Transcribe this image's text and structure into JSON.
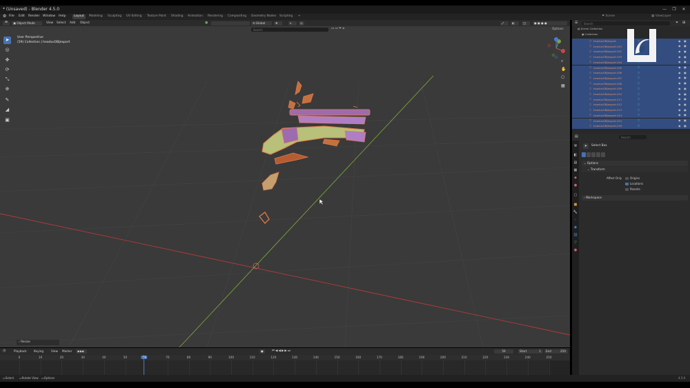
{
  "window": {
    "title": "* (Unsaved) - Blender 4.5.0",
    "controls": [
      "—",
      "❐",
      "✕"
    ]
  },
  "menu": [
    "File",
    "Edit",
    "Render",
    "Window",
    "Help"
  ],
  "workspaces": [
    {
      "label": "Layout",
      "active": true
    },
    {
      "label": "Modeling"
    },
    {
      "label": "Sculpting"
    },
    {
      "label": "UV Editing"
    },
    {
      "label": "Texture Paint"
    },
    {
      "label": "Shading"
    },
    {
      "label": "Animation"
    },
    {
      "label": "Rendering"
    },
    {
      "label": "Compositing"
    },
    {
      "label": "Geometry Nodes"
    },
    {
      "label": "Scripting"
    },
    {
      "label": "+"
    }
  ],
  "scene_label": "Scene",
  "view_layer_label": "ViewLayer",
  "viewport_header": {
    "mode": "Object Mode",
    "menus": [
      "View",
      "Select",
      "Add",
      "Object"
    ],
    "orientation": "Global",
    "search_placeholder": "Search",
    "options_label": "Options"
  },
  "viewport": {
    "perspective": "User Perspective",
    "collection": "(59) Collection | headusOBJexport"
  },
  "redo_panel": "Resize",
  "outliner": {
    "search_placeholder": "Search",
    "root": "Scene Collection",
    "collection": "Collection",
    "items": [
      "headusOBJexport",
      "headusOBJexport.001",
      "headusOBJexport.002",
      "headusOBJexport.003",
      "headusOBJexport.004",
      "headusOBJexport.005",
      "headusOBJexport.006",
      "headusOBJexport.007",
      "headusOBJexport.008",
      "headusOBJexport.009",
      "headusOBJexport.010",
      "headusOBJexport.011",
      "headusOBJexport.012",
      "headusOBJexport.013",
      "headusOBJexport.014",
      "headusOBJexport.015",
      "headusOBJexport.016"
    ]
  },
  "properties": {
    "search_placeholder": "Search",
    "tool_name": "Select Box",
    "options_panel": "Options",
    "transform_panel": "Transform",
    "affect_only_label": "Affect Only",
    "affect_only": [
      {
        "label": "Origins",
        "checked": false
      },
      {
        "label": "Locations",
        "checked": true
      },
      {
        "label": "Parents",
        "checked": false
      }
    ],
    "workspace_panel": "Workspace"
  },
  "timeline": {
    "menus": [
      "Playback",
      "Keying",
      "View",
      "Marker"
    ],
    "current_frame": "59",
    "start_label": "Start",
    "start": "1",
    "end_label": "End",
    "end": "250",
    "ruler": [
      "0",
      "10",
      "20",
      "30",
      "40",
      "50",
      "59",
      "70",
      "80",
      "90",
      "100",
      "110",
      "120",
      "130",
      "140",
      "150",
      "160",
      "170",
      "180",
      "190",
      "200",
      "210",
      "220",
      "230",
      "240",
      "250"
    ]
  },
  "statusbar": {
    "items": [
      "Select",
      "Rotate View",
      "Options"
    ],
    "version": "4.5.0"
  },
  "colors": {
    "accent": "#4772b3",
    "viewport": "#3a3a3a",
    "x_axis": "#b33a3a",
    "y_axis": "#7aa33a",
    "selected_row": "#334d80",
    "object_orange": "#e07a45"
  }
}
